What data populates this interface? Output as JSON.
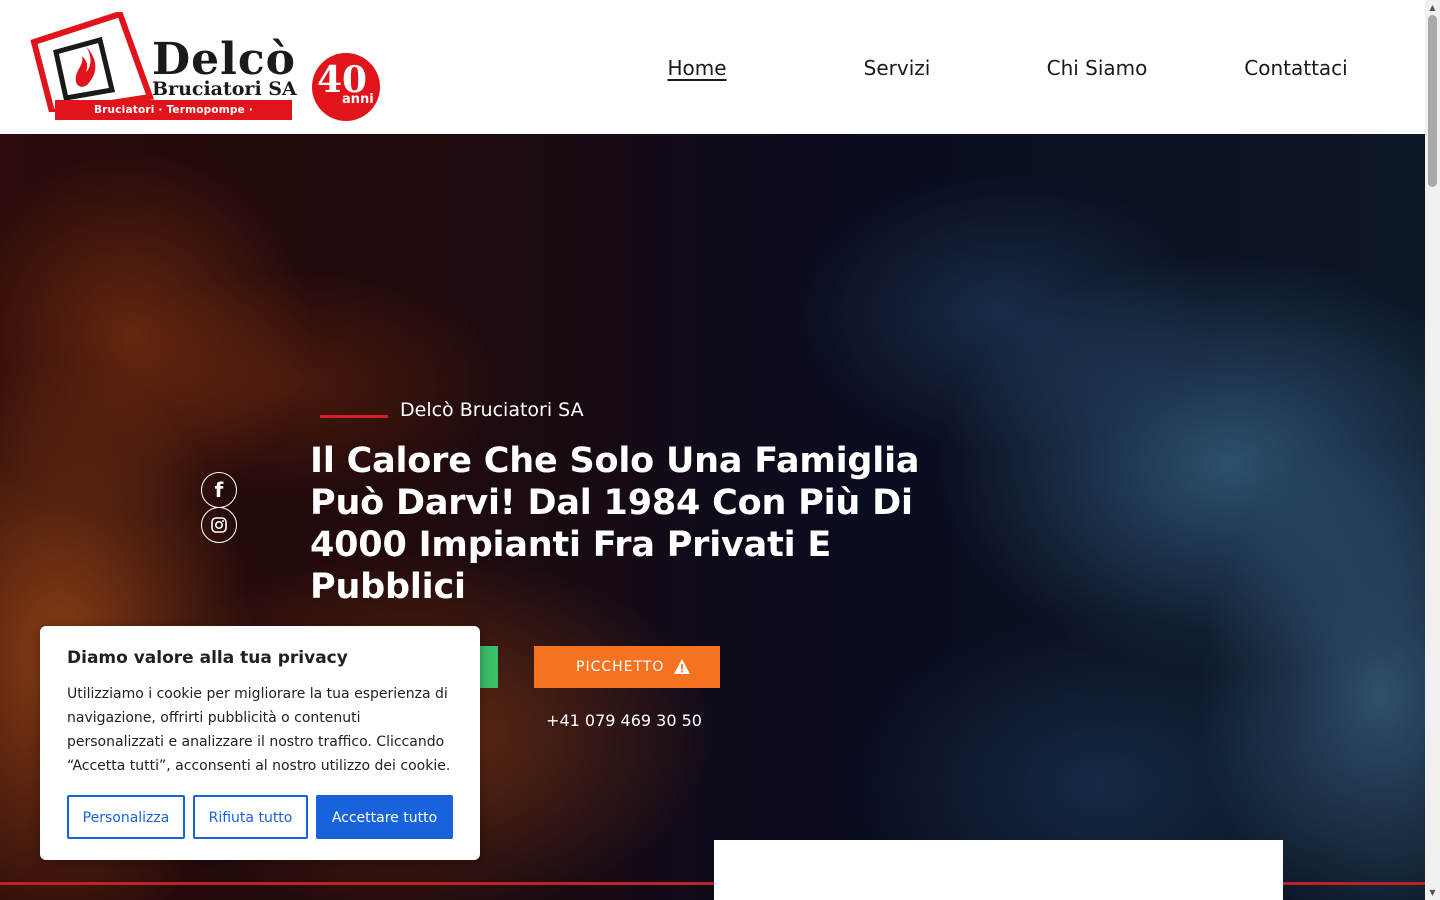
{
  "header": {
    "logo": {
      "name": "Delcò",
      "subname": "Bruciatori SA",
      "tagline": "Bruciatori · Termopompe · Climatizzatori",
      "badge_number": "40",
      "badge_word": "anni"
    },
    "nav": [
      {
        "label": "Home",
        "active": true
      },
      {
        "label": "Servizi",
        "active": false
      },
      {
        "label": "Chi Siamo",
        "active": false
      },
      {
        "label": "Contattaci",
        "active": false
      }
    ]
  },
  "hero": {
    "eyebrow": "Delcò Bruciatori SA",
    "headline": "Il Calore Che Solo Una Famiglia Può Darvi! Dal 1984 Con Più Di 4000 Impianti Fra Privati E Pubblici",
    "social_icons": [
      "facebook-icon",
      "instagram-icon"
    ],
    "picchetto_button": "PICCHETTO",
    "picchetto_icon": "warning-icon",
    "phone": "+41 079 469 30 50"
  },
  "cookie_banner": {
    "title": "Diamo valore alla tua privacy",
    "text": "Utilizziamo i cookie per migliorare la tua esperienza di navigazione, offrirti pubblicità o contenuti personalizzati e analizzare il nostro traffico. Cliccando “Accetta tutti”, acconsenti al nostro utilizzo dei cookie.",
    "buttons": {
      "customize": "Personalizza",
      "reject": "Rifiuta tutto",
      "accept": "Accettare tutto"
    }
  },
  "colors": {
    "brand_red": "#e1141b",
    "picchetto_orange": "#f57320",
    "whatsapp_green": "#3bbf6a",
    "cookie_blue": "#1863dc"
  }
}
